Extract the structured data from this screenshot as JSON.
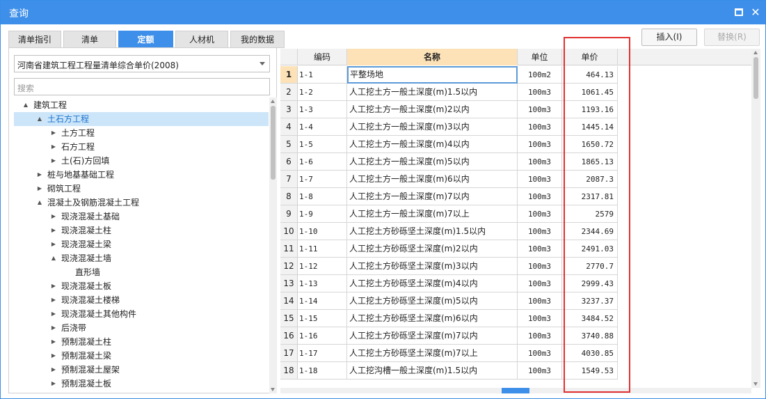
{
  "window": {
    "title": "查询"
  },
  "tabs": [
    {
      "label": "清单指引",
      "active": false
    },
    {
      "label": "清单",
      "active": false
    },
    {
      "label": "定额",
      "active": true
    },
    {
      "label": "人材机",
      "active": false
    },
    {
      "label": "我的数据",
      "active": false
    }
  ],
  "buttons": {
    "insert": "插入(I)",
    "replace": "替换(R)"
  },
  "library_select": {
    "value": "河南省建筑工程工程量清单综合单价(2008)"
  },
  "search": {
    "placeholder": "搜索"
  },
  "tree": [
    {
      "label": "建筑工程",
      "level": 0,
      "toggle": "▲"
    },
    {
      "label": "土石方工程",
      "level": 1,
      "toggle": "▲",
      "selected": true
    },
    {
      "label": "土方工程",
      "level": 2,
      "toggle": "▶"
    },
    {
      "label": "石方工程",
      "level": 2,
      "toggle": "▶"
    },
    {
      "label": "土(石)方回填",
      "level": 2,
      "toggle": "▶"
    },
    {
      "label": "桩与地基基础工程",
      "level": 1,
      "toggle": "▶"
    },
    {
      "label": "砌筑工程",
      "level": 1,
      "toggle": "▶"
    },
    {
      "label": "混凝土及钢筋混凝土工程",
      "level": 1,
      "toggle": "▲"
    },
    {
      "label": "现浇混凝土基础",
      "level": 2,
      "toggle": "▶"
    },
    {
      "label": "现浇混凝土柱",
      "level": 2,
      "toggle": "▶"
    },
    {
      "label": "现浇混凝土梁",
      "level": 2,
      "toggle": "▶"
    },
    {
      "label": "现浇混凝土墙",
      "level": 2,
      "toggle": "▲"
    },
    {
      "label": "直形墙",
      "level": 3,
      "toggle": ""
    },
    {
      "label": "现浇混凝土板",
      "level": 2,
      "toggle": "▶"
    },
    {
      "label": "现浇混凝土楼梯",
      "level": 2,
      "toggle": "▶"
    },
    {
      "label": "现浇混凝土其他构件",
      "level": 2,
      "toggle": "▶"
    },
    {
      "label": "后浇带",
      "level": 2,
      "toggle": "▶"
    },
    {
      "label": "预制混凝土柱",
      "level": 2,
      "toggle": "▶"
    },
    {
      "label": "预制混凝土梁",
      "level": 2,
      "toggle": "▶"
    },
    {
      "label": "预制混凝土屋架",
      "level": 2,
      "toggle": "▶"
    },
    {
      "label": "预制混凝土板",
      "level": 2,
      "toggle": "▶"
    }
  ],
  "grid": {
    "columns": {
      "code": "编码",
      "name": "名称",
      "unit": "单位",
      "price": "单价"
    },
    "rows": [
      {
        "n": "1",
        "code": "1-1",
        "name": "平整场地",
        "unit": "100m2",
        "price": "464.13"
      },
      {
        "n": "2",
        "code": "1-2",
        "name": "人工挖土方一般土深度(m)1.5以内",
        "unit": "100m3",
        "price": "1061.45"
      },
      {
        "n": "3",
        "code": "1-3",
        "name": "人工挖土方一般土深度(m)2以内",
        "unit": "100m3",
        "price": "1193.16"
      },
      {
        "n": "4",
        "code": "1-4",
        "name": "人工挖土方一般土深度(m)3以内",
        "unit": "100m3",
        "price": "1445.14"
      },
      {
        "n": "5",
        "code": "1-5",
        "name": "人工挖土方一般土深度(m)4以内",
        "unit": "100m3",
        "price": "1650.72"
      },
      {
        "n": "6",
        "code": "1-6",
        "name": "人工挖土方一般土深度(m)5以内",
        "unit": "100m3",
        "price": "1865.13"
      },
      {
        "n": "7",
        "code": "1-7",
        "name": "人工挖土方一般土深度(m)6以内",
        "unit": "100m3",
        "price": "2087.3"
      },
      {
        "n": "8",
        "code": "1-8",
        "name": "人工挖土方一般土深度(m)7以内",
        "unit": "100m3",
        "price": "2317.81"
      },
      {
        "n": "9",
        "code": "1-9",
        "name": "人工挖土方一般土深度(m)7以上",
        "unit": "100m3",
        "price": "2579"
      },
      {
        "n": "10",
        "code": "1-10",
        "name": "人工挖土方砂砾坚土深度(m)1.5以内",
        "unit": "100m3",
        "price": "2344.69"
      },
      {
        "n": "11",
        "code": "1-11",
        "name": "人工挖土方砂砾坚土深度(m)2以内",
        "unit": "100m3",
        "price": "2491.03"
      },
      {
        "n": "12",
        "code": "1-12",
        "name": "人工挖土方砂砾坚土深度(m)3以内",
        "unit": "100m3",
        "price": "2770.7"
      },
      {
        "n": "13",
        "code": "1-13",
        "name": "人工挖土方砂砾坚土深度(m)4以内",
        "unit": "100m3",
        "price": "2999.43"
      },
      {
        "n": "14",
        "code": "1-14",
        "name": "人工挖土方砂砾坚土深度(m)5以内",
        "unit": "100m3",
        "price": "3237.37"
      },
      {
        "n": "15",
        "code": "1-15",
        "name": "人工挖土方砂砾坚土深度(m)6以内",
        "unit": "100m3",
        "price": "3484.52"
      },
      {
        "n": "16",
        "code": "1-16",
        "name": "人工挖土方砂砾坚土深度(m)7以内",
        "unit": "100m3",
        "price": "3740.88"
      },
      {
        "n": "17",
        "code": "1-17",
        "name": "人工挖土方砂砾坚土深度(m)7以上",
        "unit": "100m3",
        "price": "4030.85"
      },
      {
        "n": "18",
        "code": "1-18",
        "name": "人工挖沟槽一般土深度(m)1.5以内",
        "unit": "100m3",
        "price": "1549.53"
      }
    ]
  },
  "colors": {
    "accent": "#3e8fe9",
    "header_highlight": "#fde2b8",
    "annotation": "#e03030"
  }
}
